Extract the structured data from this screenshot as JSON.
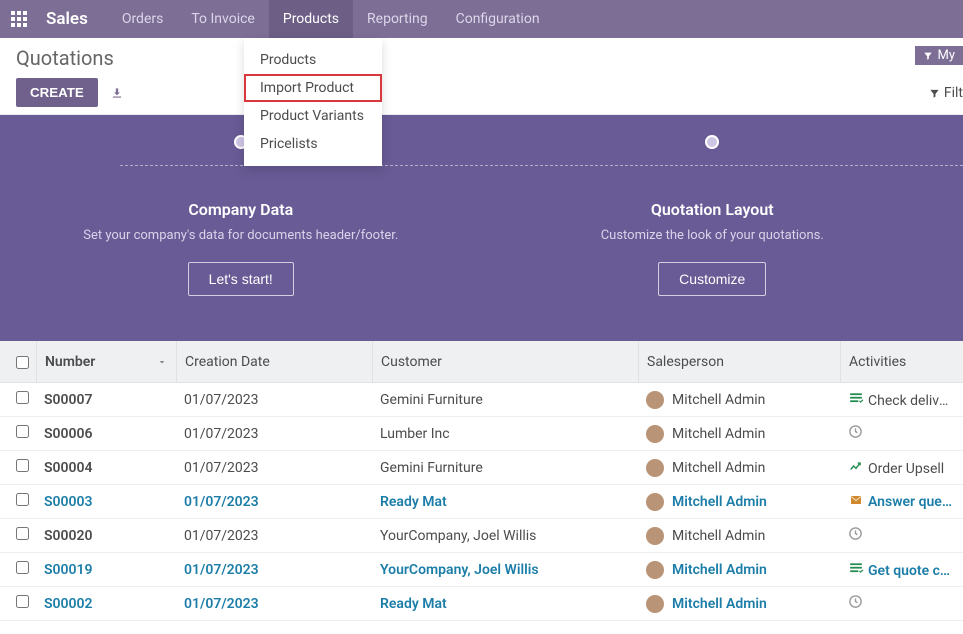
{
  "topnav": {
    "brand": "Sales",
    "items": [
      "Orders",
      "To Invoice",
      "Products",
      "Reporting",
      "Configuration"
    ],
    "active_index": 2
  },
  "dropdown": {
    "items": [
      "Products",
      "Import Product",
      "Product Variants",
      "Pricelists"
    ],
    "highlight_index": 1
  },
  "control": {
    "title": "Quotations",
    "create": "CREATE",
    "my_chip": "My",
    "filters": "Filt"
  },
  "banner": {
    "steps": [
      {
        "title": "Company Data",
        "subtitle": "Set your company's data for documents header/footer.",
        "button": "Let's start!"
      },
      {
        "title": "Quotation Layout",
        "subtitle": "Customize the look of your quotations.",
        "button": "Customize"
      }
    ]
  },
  "list": {
    "columns": [
      "Number",
      "Creation Date",
      "Customer",
      "Salesperson",
      "Activities"
    ],
    "rows": [
      {
        "number": "S00007",
        "date": "01/07/2023",
        "customer": "Gemini Furniture",
        "salesperson": "Mitchell Admin",
        "activity_icon": "task-green",
        "activity_text": "Check delivery re",
        "highlight": false
      },
      {
        "number": "S00006",
        "date": "01/07/2023",
        "customer": "Lumber Inc",
        "salesperson": "Mitchell Admin",
        "activity_icon": "clock",
        "activity_text": "",
        "highlight": false
      },
      {
        "number": "S00004",
        "date": "01/07/2023",
        "customer": "Gemini Furniture",
        "salesperson": "Mitchell Admin",
        "activity_icon": "chart-green",
        "activity_text": "Order Upsell",
        "highlight": false
      },
      {
        "number": "S00003",
        "date": "01/07/2023",
        "customer": "Ready Mat",
        "salesperson": "Mitchell Admin",
        "activity_icon": "mail-orange",
        "activity_text": "Answer questions",
        "highlight": true
      },
      {
        "number": "S00020",
        "date": "01/07/2023",
        "customer": "YourCompany, Joel Willis",
        "salesperson": "Mitchell Admin",
        "activity_icon": "clock",
        "activity_text": "",
        "highlight": false
      },
      {
        "number": "S00019",
        "date": "01/07/2023",
        "customer": "YourCompany, Joel Willis",
        "salesperson": "Mitchell Admin",
        "activity_icon": "task-green",
        "activity_text": "Get quote confirm",
        "highlight": true
      },
      {
        "number": "S00002",
        "date": "01/07/2023",
        "customer": "Ready Mat",
        "salesperson": "Mitchell Admin",
        "activity_icon": "clock",
        "activity_text": "",
        "highlight": true
      }
    ]
  }
}
